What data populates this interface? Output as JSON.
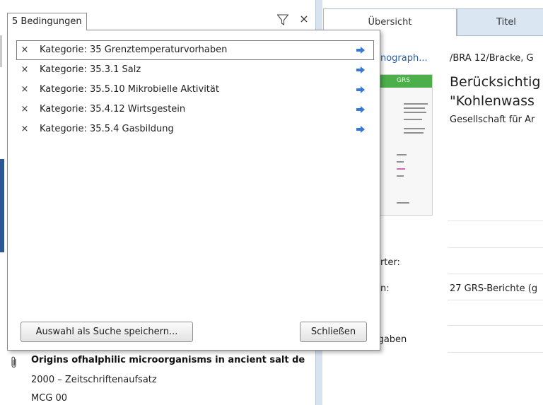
{
  "filter": {
    "conditions_tab": "5 Bedingungen",
    "funnel_icon": "funnel-icon",
    "close_glyph": "×"
  },
  "popup": {
    "conditions": [
      {
        "remove": "×",
        "label": "Kategorie: 35 Grenztemperaturvorhaben",
        "selected": true
      },
      {
        "remove": "×",
        "label": "Kategorie: 35.3.1 Salz",
        "selected": false
      },
      {
        "remove": "×",
        "label": "Kategorie: 35.5.10 Mikrobielle Aktivität",
        "selected": false
      },
      {
        "remove": "×",
        "label": "Kategorie: 35.4.12 Wirtsgestein",
        "selected": false
      },
      {
        "remove": "×",
        "label": "Kategorie: 35.5.4 Gasbildung",
        "selected": false
      }
    ],
    "save_button": "Auswahl als Suche speichern...",
    "close_button": "Schließen",
    "arrow_color": "#3a78d6"
  },
  "result": {
    "title": "Origins ofhalphilic microorganisms in ancient salt de",
    "meta": "2000 – Zeitschriftenaufsatz",
    "code": "MCG 00"
  },
  "detail": {
    "tabs": [
      "Übersicht",
      "Titel"
    ],
    "kind": "onograph...",
    "authors": "/BRA 12/Bracke, G",
    "title_line1": "Berücksichtig",
    "title_line2": "\"Kohlenwass",
    "publisher": "Gesellschaft für Ar",
    "cover_logo": "GRS",
    "label_keywords": "örter:",
    "label_series": "en:",
    "value_series": "27 GRS-Berichte (g",
    "label_tasks": "fgaben"
  },
  "colors": {
    "accent_blue": "#2b5797",
    "link_blue": "#2b5fa3",
    "tab_inactive": "#dbe6f3",
    "cover_green": "#4daf4a"
  }
}
